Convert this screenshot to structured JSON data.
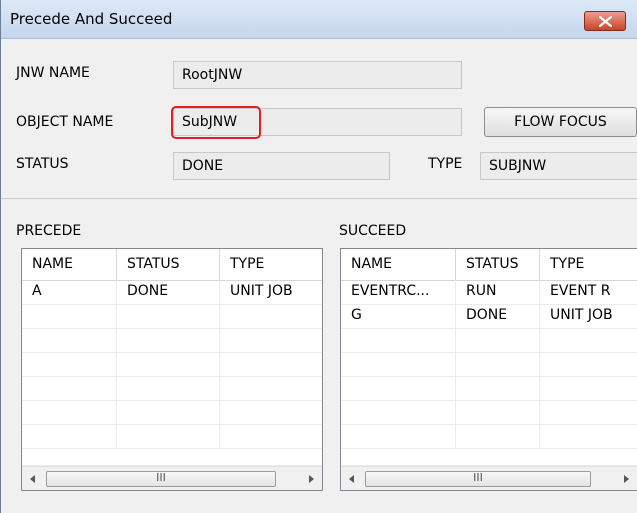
{
  "window": {
    "title": "Precede And Succeed"
  },
  "form": {
    "jnw_name_label": "JNW NAME",
    "jnw_name_value": "RootJNW",
    "object_name_label": "OBJECT NAME",
    "object_name_value": "SubJNW",
    "status_label": "STATUS",
    "status_value": "DONE",
    "type_label": "TYPE",
    "type_value": "SUBJNW",
    "flow_focus_label": "FLOW FOCUS"
  },
  "precede": {
    "label": "PRECEDE",
    "columns": [
      "NAME",
      "STATUS",
      "TYPE"
    ],
    "rows": [
      [
        "A",
        "DONE",
        "UNIT JOB"
      ]
    ],
    "scroll_thumb": "III"
  },
  "succeed": {
    "label": "SUCCEED",
    "columns": [
      "NAME",
      "STATUS",
      "TYPE"
    ],
    "rows": [
      [
        "EVENTRC...",
        "RUN",
        "EVENT R"
      ],
      [
        "G",
        "DONE",
        "UNIT JOB"
      ]
    ],
    "scroll_thumb": "III"
  },
  "colors": {
    "highlight": "#e02020",
    "close_button": "#c8442b"
  },
  "icons": {
    "close": "close-icon",
    "scroll_left": "scroll-left-arrow-icon",
    "scroll_right": "scroll-right-arrow-icon"
  }
}
